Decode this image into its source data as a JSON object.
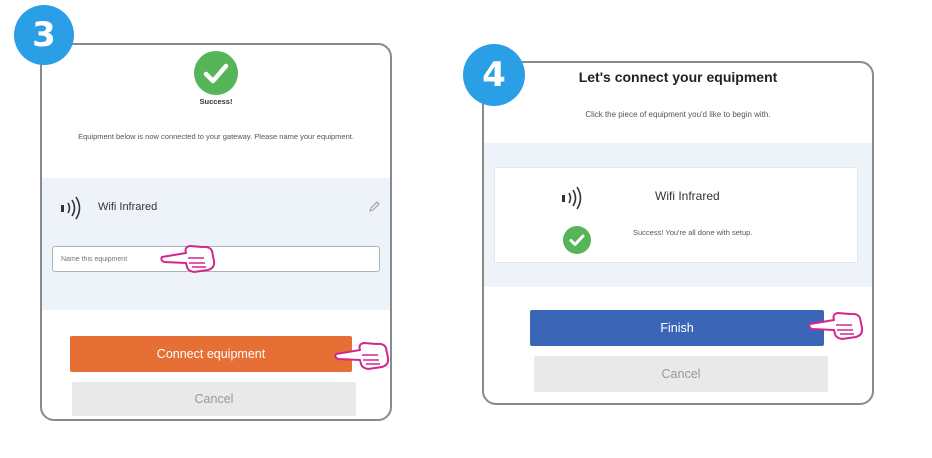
{
  "step3": {
    "badge": "3",
    "success_title": "Success!",
    "message": "Equipment below is now connected to your gateway. Please name your equipment.",
    "equipment_name": "Wifi  Infrared",
    "name_input_placeholder": "Name this equipment",
    "connect_label": "Connect equipment",
    "cancel_label": "Cancel"
  },
  "step4": {
    "badge": "4",
    "title": "Let's connect your equipment",
    "subtitle": "Click the piece of equipment you'd like to begin with.",
    "equipment_name": "Wifi  Infrared",
    "status": "Success! You're all done with setup.",
    "finish_label": "Finish",
    "cancel_label": "Cancel"
  },
  "colors": {
    "badge": "#2b9fe6",
    "success_green": "#56b459",
    "connect_orange": "#e56f34",
    "finish_blue": "#3b66b8",
    "cancel_gray": "#e9e9e9",
    "hand_pink": "#d2278f"
  },
  "icons": [
    "wifi-infrared-icon",
    "checkmark-icon",
    "edit-icon",
    "pointing-hand-icon"
  ]
}
